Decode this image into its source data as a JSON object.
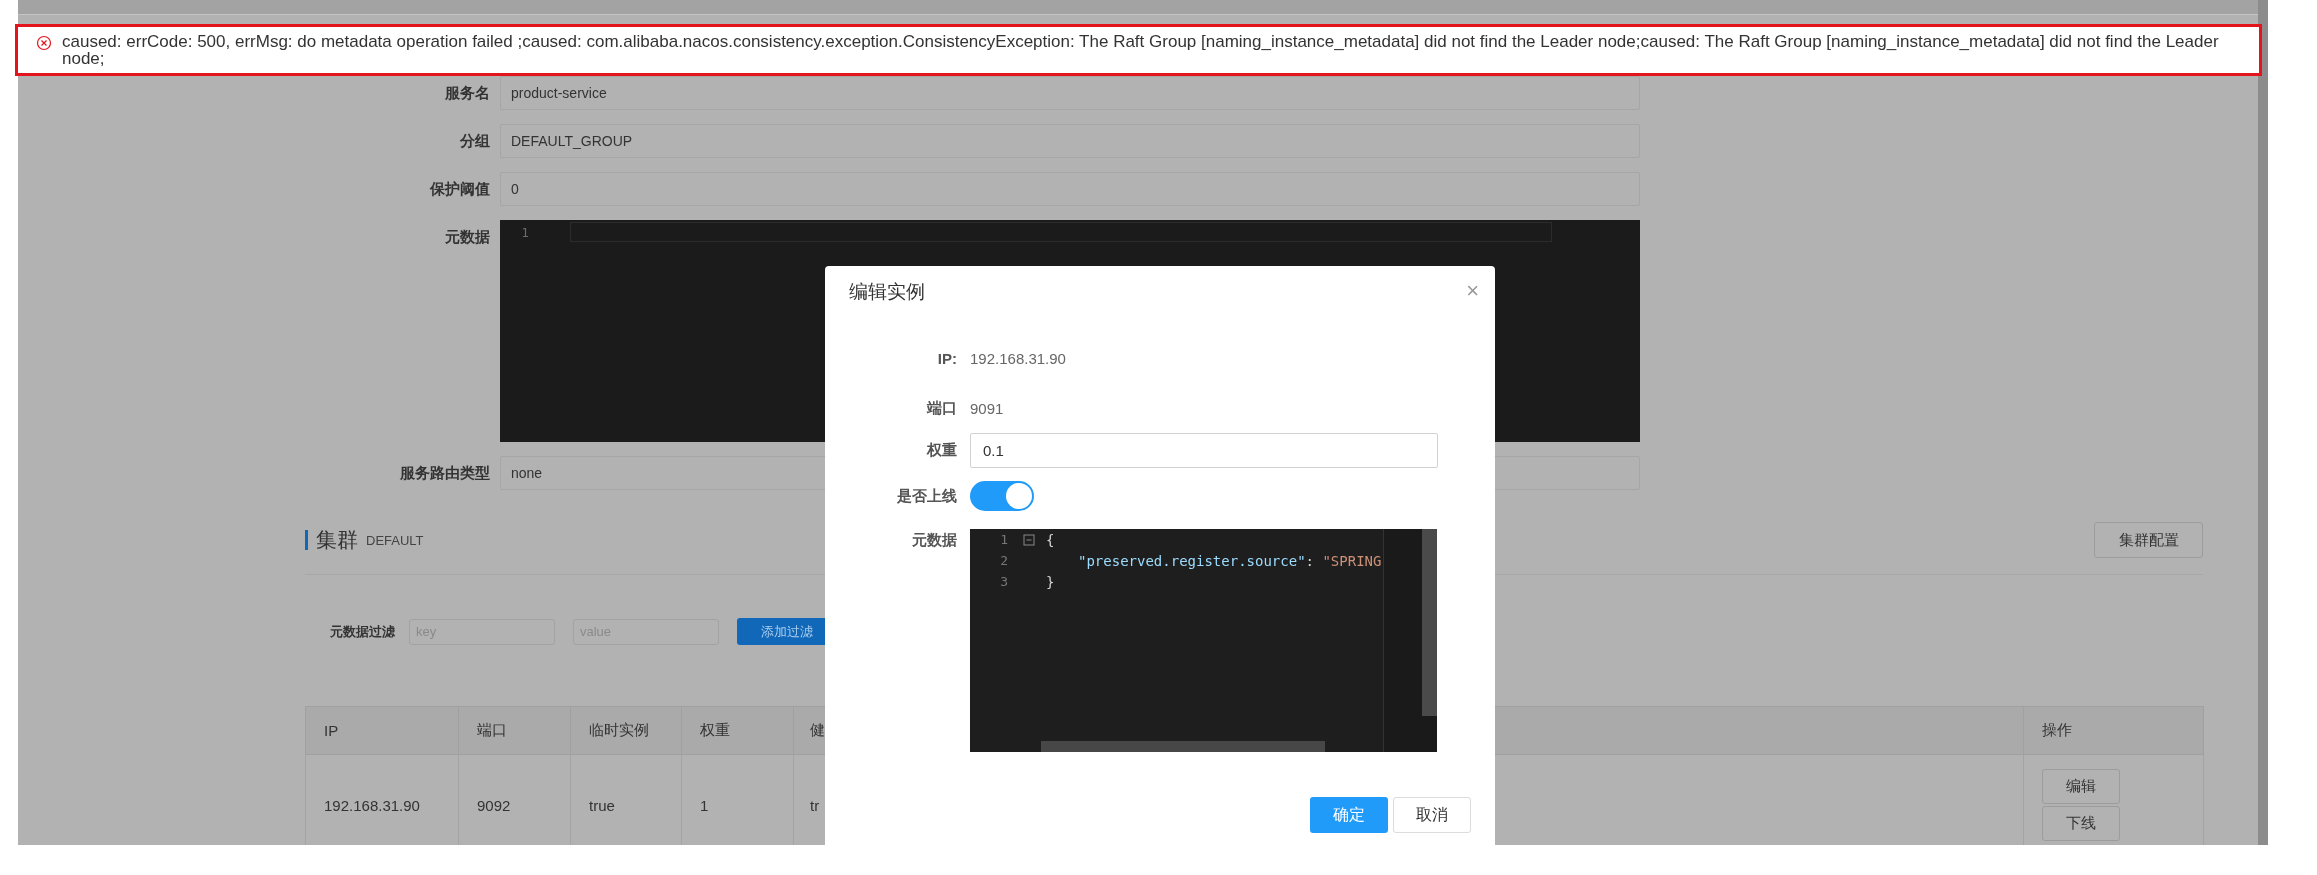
{
  "error_banner": {
    "message": "caused: errCode: 500, errMsg: do metadata operation failed ;caused: com.alibaba.nacos.consistency.exception.ConsistencyException: The Raft Group [naming_instance_metadata] did not find the Leader node;caused: The Raft Group [naming_instance_metadata] did not find the Leader node;"
  },
  "service_form": {
    "rows": [
      {
        "kind": "input",
        "label": "服务名",
        "value": "product-service"
      },
      {
        "kind": "input",
        "label": "分组",
        "value": "DEFAULT_GROUP"
      },
      {
        "kind": "input",
        "label": "保护阈值",
        "value": "0"
      },
      {
        "kind": "editor",
        "label": "元数据",
        "line_numbers": [
          "1"
        ]
      },
      {
        "kind": "input",
        "label": "服务路由类型",
        "value": "none"
      }
    ]
  },
  "cluster": {
    "title": "集群",
    "name": "DEFAULT",
    "config_button": "集群配置"
  },
  "filter": {
    "label": "元数据过滤",
    "key_placeholder": "key",
    "value_placeholder": "value",
    "button": "添加过滤"
  },
  "table": {
    "columns": [
      "IP",
      "端口",
      "临时实例",
      "权重",
      "健",
      "操作"
    ],
    "rows": [
      {
        "cells": [
          "192.168.31.90",
          "9092",
          "true",
          "1",
          "tr"
        ],
        "actions": [
          "编辑",
          "下线"
        ]
      }
    ]
  },
  "dialog": {
    "title": "编辑实例",
    "close": "×",
    "fields": [
      {
        "kind": "text",
        "label": "IP:",
        "value": "192.168.31.90"
      },
      {
        "kind": "text",
        "label": "端口",
        "value": "9091"
      },
      {
        "kind": "input",
        "label": "权重",
        "value": "0.1"
      },
      {
        "kind": "switch",
        "label": "是否上线",
        "on": true
      },
      {
        "kind": "code",
        "label": "元数据",
        "lines": [
          {
            "number": "1",
            "fold": true,
            "tokens": [
              {
                "kind": "punct",
                "text": "{"
              }
            ]
          },
          {
            "number": "2",
            "fold": false,
            "tokens": [
              {
                "kind": "key",
                "text": "\"preserved.register.source\""
              },
              {
                "kind": "punct",
                "text": ": "
              },
              {
                "kind": "string",
                "text": "\"SPRING"
              }
            ]
          },
          {
            "number": "3",
            "fold": false,
            "tokens": [
              {
                "kind": "punct",
                "text": "}"
              }
            ]
          }
        ]
      }
    ],
    "buttons": [
      {
        "kind": "primary",
        "label": "确定"
      },
      {
        "kind": "default",
        "label": "取消"
      }
    ]
  }
}
